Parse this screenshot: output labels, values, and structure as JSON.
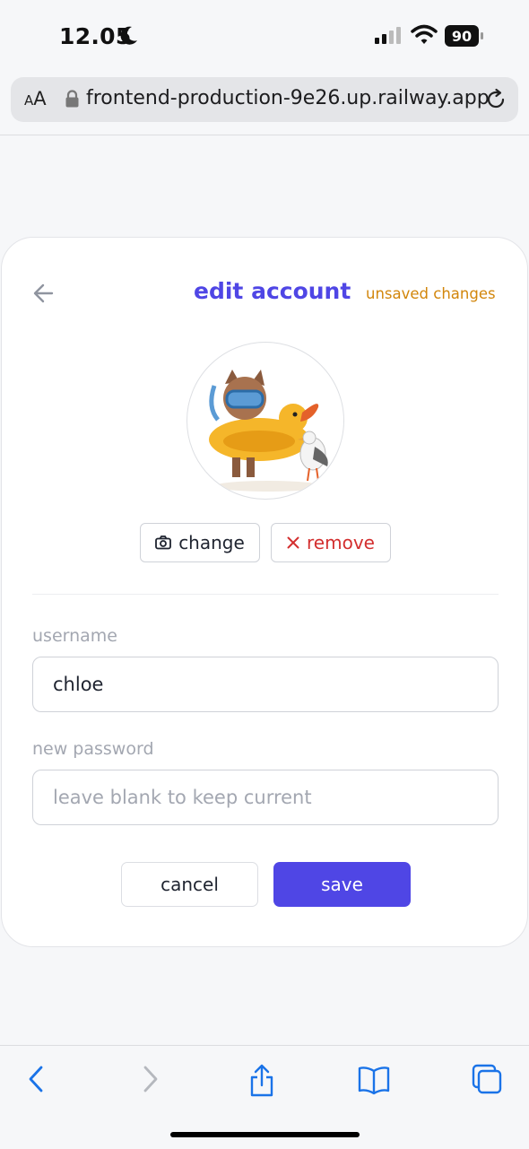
{
  "status": {
    "time": "12.05",
    "battery": "90"
  },
  "browser": {
    "text_size_label_small": "A",
    "text_size_label_large": "A",
    "url": "frontend-production-9e26.up.railway.app"
  },
  "page": {
    "title": "edit account",
    "unsaved_label": "unsaved changes",
    "change_label": "change",
    "remove_label": "remove",
    "username_label": "username",
    "username_value": "chloe",
    "password_label": "new password",
    "password_placeholder": "leave blank to keep current",
    "cancel_label": "cancel",
    "save_label": "save"
  },
  "colors": {
    "accent": "#4f46e5",
    "warning": "#d2860b",
    "danger": "#d32f2f",
    "browser_blue": "#1a73e8"
  },
  "icons": [
    "moon-icon",
    "signal-icon",
    "wifi-icon",
    "battery-icon",
    "lock-icon",
    "reload-icon",
    "back-arrow-icon",
    "camera-icon",
    "close-icon",
    "back-icon",
    "forward-icon",
    "share-icon",
    "bookmarks-icon",
    "tabs-icon"
  ]
}
